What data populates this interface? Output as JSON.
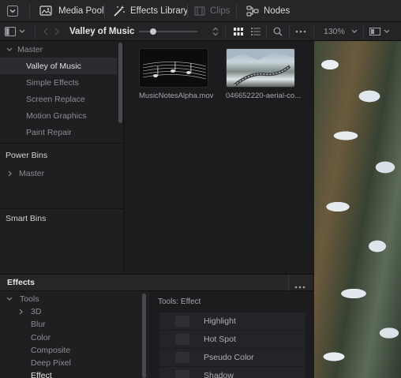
{
  "toolbar": {
    "media_pool": "Media Pool",
    "effects_library": "Effects Library",
    "clips": "Clips",
    "nodes": "Nodes"
  },
  "bar2": {
    "bin_title": "Valley of Music",
    "zoom": "130%"
  },
  "bins": {
    "master": "Master",
    "items": [
      {
        "label": "Valley of Music",
        "selected": true
      },
      {
        "label": "Simple Effects",
        "selected": false
      },
      {
        "label": "Screen Replace",
        "selected": false
      },
      {
        "label": "Motion Graphics",
        "selected": false
      },
      {
        "label": "Paint Repair",
        "selected": false
      }
    ],
    "power_bins_title": "Power Bins",
    "power_master": "Master",
    "smart_bins_title": "Smart Bins"
  },
  "media": {
    "clips": [
      {
        "name": "MusicNotesAlpha.mov"
      },
      {
        "name": "046652220-aerial-co..."
      }
    ]
  },
  "effects": {
    "title": "Effects",
    "tree": {
      "tools": "Tools",
      "items": [
        "3D",
        "Blur",
        "Color",
        "Composite",
        "Deep Pixel",
        "Effect"
      ]
    },
    "list_title": "Tools: Effect",
    "list": [
      "Highlight",
      "Hot Spot",
      "Pseudo Color",
      "Shadow"
    ]
  },
  "colors": {
    "accent_selected": "#2c2c30",
    "toolbar_bg": "#262629"
  }
}
